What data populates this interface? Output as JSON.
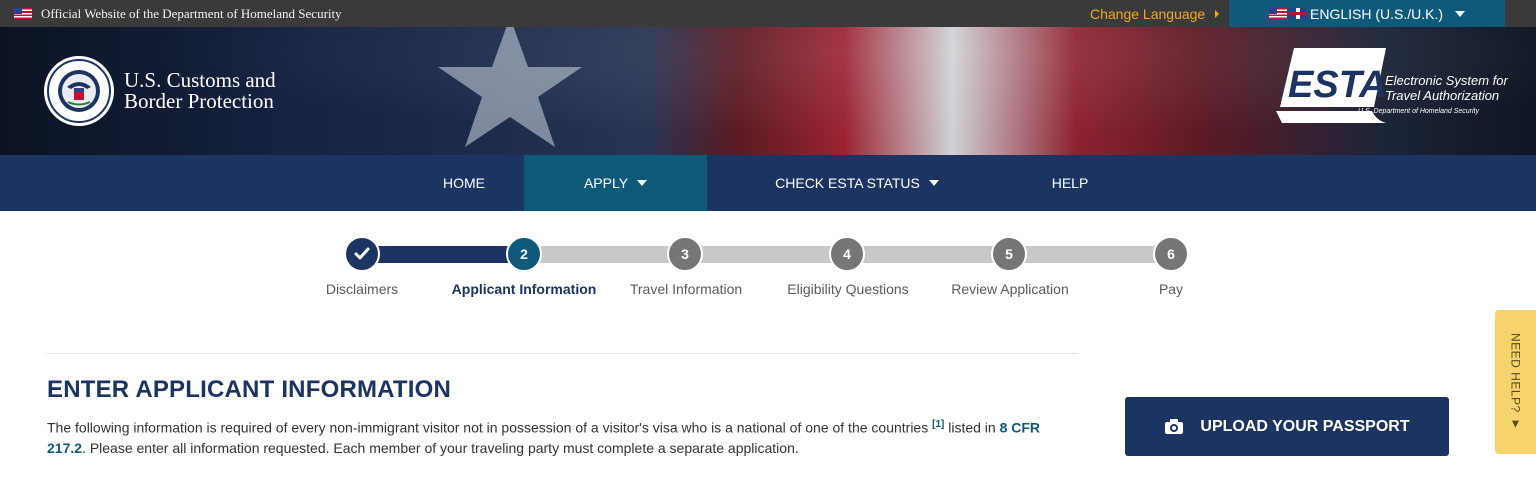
{
  "topbar": {
    "official_text": "Official Website of the Department of Homeland Security",
    "change_language": "Change Language",
    "language": "ENGLISH (U.S./U.K.)"
  },
  "header": {
    "agency_line1": "U.S. Customs and",
    "agency_line2": "Border Protection",
    "esta_logo_text": "ESTA",
    "esta_tagline_line1": "Electronic System for",
    "esta_tagline_line2": "Travel Authorization",
    "esta_department": "U.S. Department of Homeland Security"
  },
  "nav": {
    "items": [
      {
        "label": "HOME",
        "active": false,
        "dropdown": false
      },
      {
        "label": "APPLY",
        "active": true,
        "dropdown": true
      },
      {
        "label": "CHECK ESTA STATUS",
        "active": false,
        "dropdown": true
      },
      {
        "label": "HELP",
        "active": false,
        "dropdown": false
      }
    ]
  },
  "progress": {
    "steps": [
      {
        "number": "",
        "label": "Disclaimers",
        "state": "done"
      },
      {
        "number": "2",
        "label": "Applicant Information",
        "state": "current"
      },
      {
        "number": "3",
        "label": "Travel Information",
        "state": "todo"
      },
      {
        "number": "4",
        "label": "Eligibility Questions",
        "state": "todo"
      },
      {
        "number": "5",
        "label": "Review Application",
        "state": "todo"
      },
      {
        "number": "6",
        "label": "Pay",
        "state": "todo"
      }
    ]
  },
  "main": {
    "title": "ENTER APPLICANT INFORMATION",
    "intro_part1": "The following information is required of every non-immigrant visitor not in possession of a visitor's visa who is a national of one of the countries ",
    "footnote": "[1]",
    "intro_part2": " listed in ",
    "cfr_link": "8 CFR 217.2",
    "intro_part3": ". Please enter all information requested. Each member of your traveling party must complete a separate application.",
    "upload_button": "UPLOAD YOUR PASSPORT"
  },
  "need_help": "NEED HELP? ▼",
  "colors": {
    "navy": "#1c3461",
    "teal": "#0f5a7a",
    "help_tab": "#f7d36b",
    "change_language": "#f5a623"
  }
}
